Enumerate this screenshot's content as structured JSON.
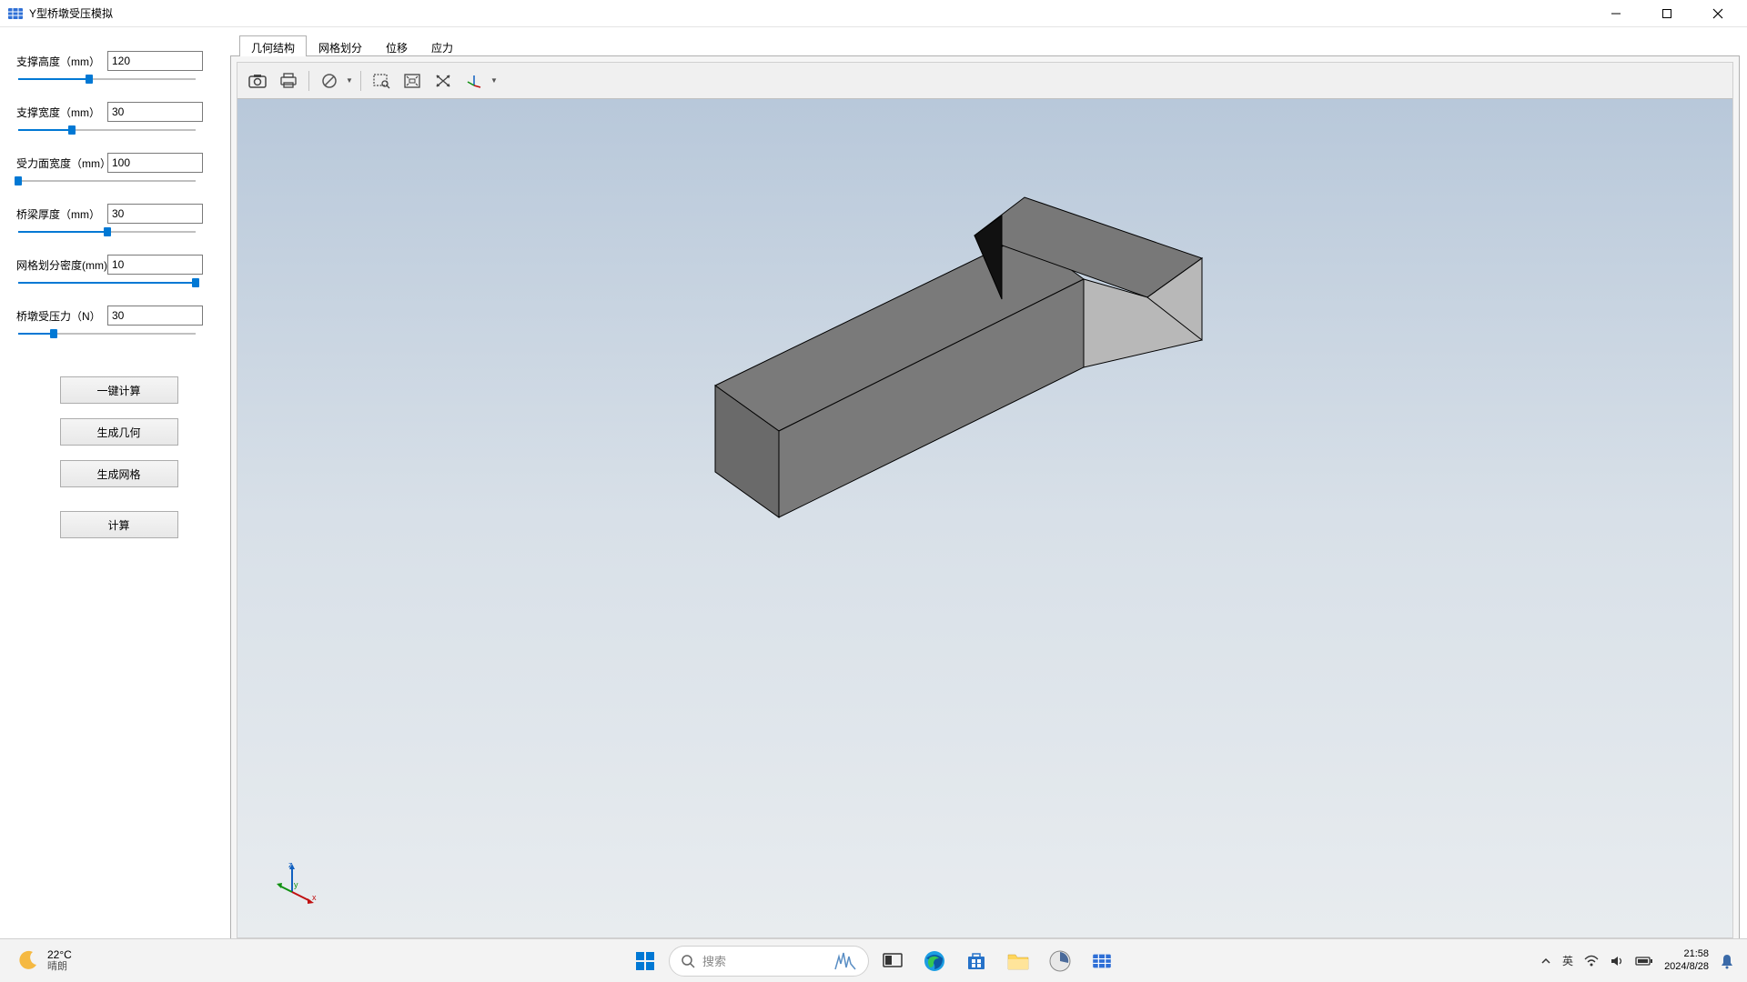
{
  "window": {
    "title": "Y型桥墩受压模拟"
  },
  "sidebar": {
    "params": [
      {
        "label": "支撑高度（mm）",
        "value": "120",
        "slider_pct": 40
      },
      {
        "label": "支撑宽度（mm）",
        "value": "30",
        "slider_pct": 30
      },
      {
        "label": "受力面宽度（mm）",
        "value": "100",
        "slider_pct": 0
      },
      {
        "label": "桥梁厚度（mm）",
        "value": "30",
        "slider_pct": 50
      },
      {
        "label": "网格划分密度(mm)",
        "value": "10",
        "slider_pct": 100
      },
      {
        "label": "桥墩受压力（N）",
        "value": "30",
        "slider_pct": 20
      }
    ],
    "buttons": {
      "one_click": "一键计算",
      "gen_geom": "生成几何",
      "gen_mesh": "生成网格",
      "compute": "计算"
    }
  },
  "tabs": {
    "items": [
      "几何结构",
      "网格划分",
      "位移",
      "应力"
    ],
    "active_index": 0
  },
  "taskbar": {
    "weather_temp": "22°C",
    "weather_cond": "晴朗",
    "search_placeholder": "搜索",
    "ime": "英",
    "time": "21:58",
    "date": "2024/8/28"
  }
}
